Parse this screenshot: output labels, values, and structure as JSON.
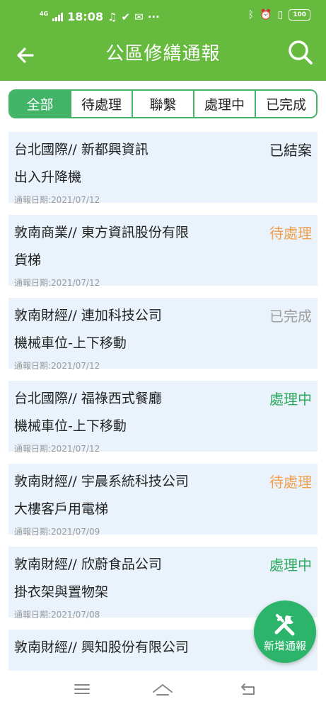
{
  "status_bar": {
    "network": "4G",
    "time": "18:08",
    "notification_icons": [
      "music-note-icon",
      "check-clipboard-icon",
      "mail-icon"
    ],
    "more": "···",
    "right_icons": [
      "bluetooth-icon",
      "alarm-icon",
      "vibrate-icon"
    ],
    "battery": "100"
  },
  "header": {
    "title": "公區修繕通報",
    "back_icon": "back-arrow-icon",
    "search_icon": "search-icon",
    "background_color": "#66bb3f"
  },
  "tabs": [
    {
      "label": "全部",
      "active": true
    },
    {
      "label": "待處理",
      "active": false
    },
    {
      "label": "聯繫",
      "active": false
    },
    {
      "label": "處理中",
      "active": false
    },
    {
      "label": "已完成",
      "active": false
    }
  ],
  "items": [
    {
      "line1": "台北國際// 新都興資訊",
      "line2": "出入升降機",
      "date": "通報日期:2021/07/12",
      "status": "已結案",
      "status_color": "#222222"
    },
    {
      "line1": "敦南商業// 東方資訊股份有限",
      "line2": "貨梯",
      "date": "通報日期:2021/07/12",
      "status": "待處理",
      "status_color": "#f0a050"
    },
    {
      "line1": "敦南財經// 連加科技公司",
      "line2": "機械車位-上下移動",
      "date": "通報日期:2021/07/12",
      "status": "已完成",
      "status_color": "#a0a0a0"
    },
    {
      "line1": "台北國際// 福祿西式餐廳",
      "line2": "機械車位-上下移動",
      "date": "通報日期:2021/07/12",
      "status": "處理中",
      "status_color": "#2eaa5e"
    },
    {
      "line1": "敦南財經// 宇晨系統科技公司",
      "line2": "大樓客戶用電梯",
      "date": "通報日期:2021/07/09",
      "status": "待處理",
      "status_color": "#f0a050"
    },
    {
      "line1": "敦南財經// 欣蔚食品公司",
      "line2": "掛衣架與置物架",
      "date": "通報日期:2021/07/08",
      "status": "處理中",
      "status_color": "#2eaa5e"
    },
    {
      "line1": "敦南財經// 興知股份有限公司",
      "line2": "",
      "date": "",
      "status": "",
      "status_color": "#222222"
    }
  ],
  "fab": {
    "label": "新增通報",
    "icon": "tools-icon"
  },
  "nav_bar": {
    "icons": [
      "menu-icon",
      "home-icon",
      "back-icon"
    ]
  }
}
